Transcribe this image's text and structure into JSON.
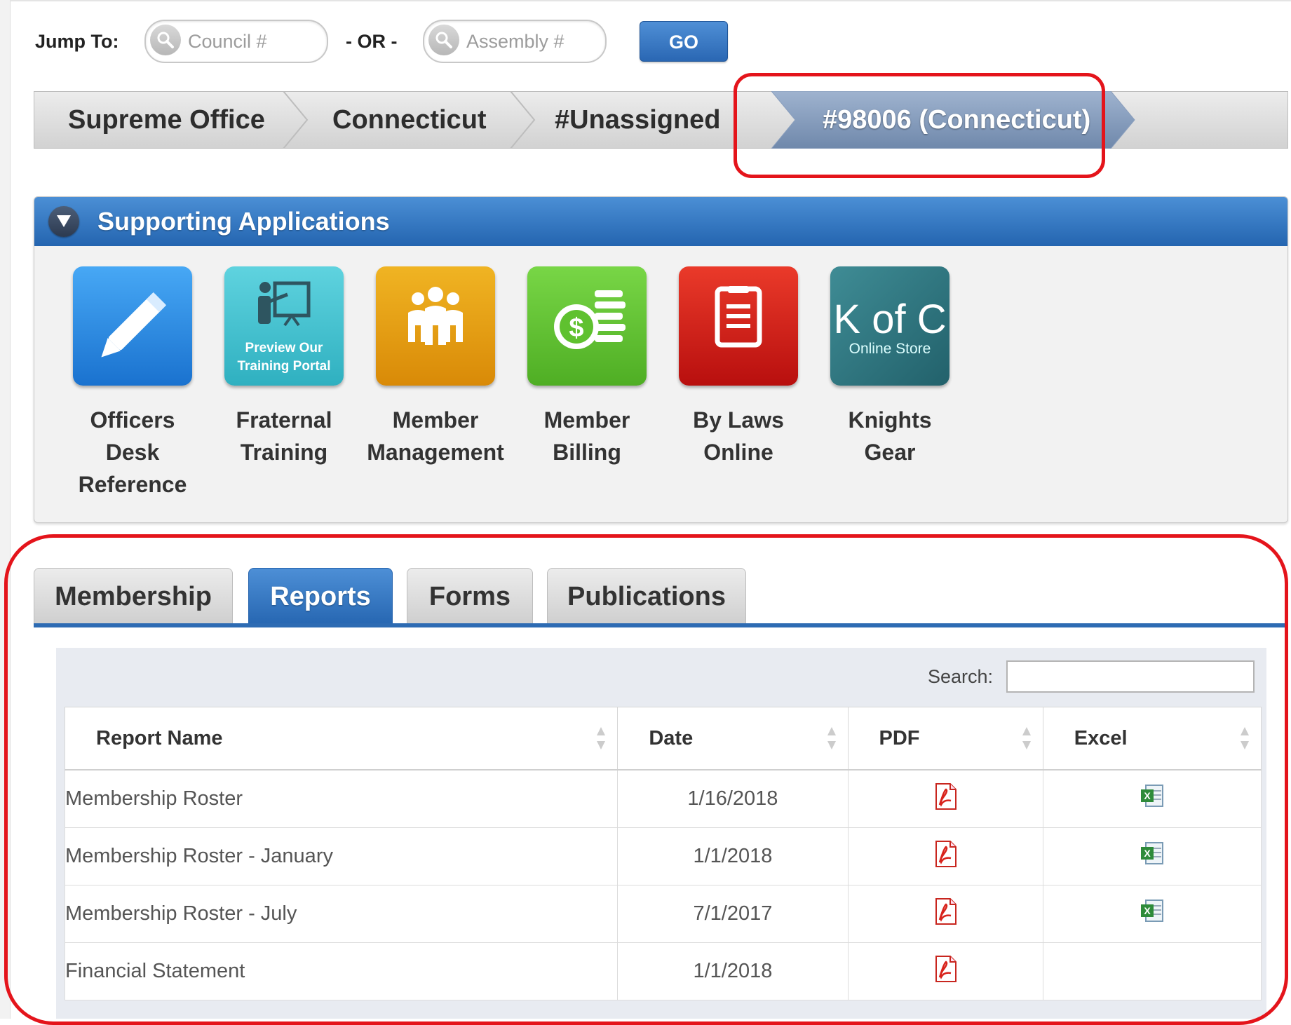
{
  "jump": {
    "label": "Jump To:",
    "council_placeholder": "Council #",
    "or_label": "- OR -",
    "assembly_placeholder": "Assembly #",
    "go_label": "GO"
  },
  "breadcrumb": {
    "items": [
      "Supreme Office",
      "Connecticut",
      "#Unassigned",
      "#98006 (Connecticut)"
    ]
  },
  "supporting_apps": {
    "title": "Supporting Applications",
    "training_tile_text_1": "Preview Our",
    "training_tile_text_2": "Training Portal",
    "kofc_tile_text": "K of C",
    "kofc_tile_subtext": "Online Store",
    "apps": [
      {
        "line1": "Officers",
        "line2": "Desk",
        "line3": "Reference",
        "icon": "pencil-icon",
        "color": "#2f8fe3"
      },
      {
        "line1": "Fraternal",
        "line2": "Training",
        "line3": "",
        "icon": "presentation-icon",
        "color": "#3fc1cf"
      },
      {
        "line1": "Member",
        "line2": "Management",
        "line3": "",
        "icon": "people-icon",
        "color": "#e7a20f"
      },
      {
        "line1": "Member",
        "line2": "Billing",
        "line3": "",
        "icon": "coins-icon",
        "color": "#62c232"
      },
      {
        "line1": "By Laws",
        "line2": "Online",
        "line3": "",
        "icon": "document-icon",
        "color": "#d8231c"
      },
      {
        "line1": "Knights",
        "line2": "Gear",
        "line3": "",
        "icon": "kofc-store-icon",
        "color": "#2f7781"
      }
    ]
  },
  "tabs": [
    "Membership",
    "Reports",
    "Forms",
    "Publications"
  ],
  "active_tab": "Reports",
  "reports": {
    "search_label": "Search:",
    "columns": [
      "Report Name",
      "Date",
      "PDF",
      "Excel"
    ],
    "rows": [
      {
        "name": "Membership Roster",
        "date": "1/16/2018",
        "pdf": true,
        "excel": true
      },
      {
        "name": "Membership Roster - January",
        "date": "1/1/2018",
        "pdf": true,
        "excel": true
      },
      {
        "name": "Membership Roster - July",
        "date": "7/1/2017",
        "pdf": true,
        "excel": true
      },
      {
        "name": "Financial Statement",
        "date": "1/1/2018",
        "pdf": true,
        "excel": false
      }
    ]
  },
  "colors": {
    "accent_blue": "#2767b2",
    "callout_red": "#e4141b"
  }
}
